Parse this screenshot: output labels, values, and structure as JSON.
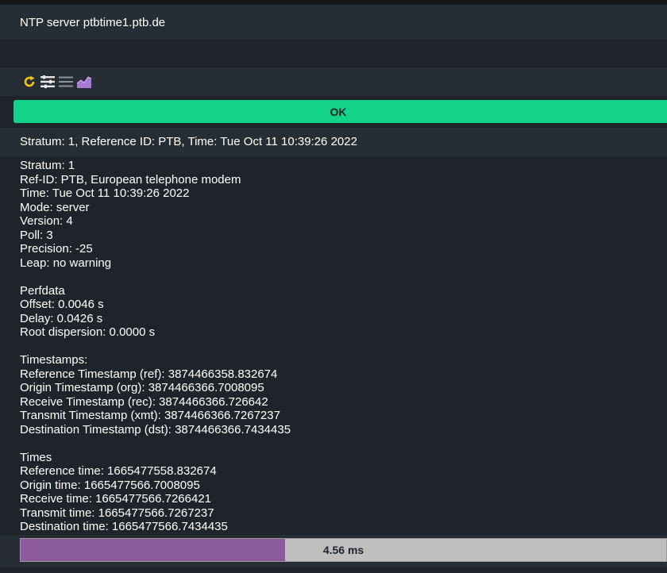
{
  "title": "NTP server ptbtime1.ptb.de",
  "toolbar": {
    "icons": [
      "refresh-icon",
      "filter-icon",
      "list-icon",
      "graph-icon"
    ]
  },
  "status": {
    "label": "OK",
    "color": "#13d389"
  },
  "summary": "Stratum: 1, Reference ID: PTB, Time: Tue Oct 11 10:39:26 2022",
  "details": {
    "lines": [
      "Stratum: 1",
      "Ref-ID: PTB, European telephone modem",
      "Time: Tue Oct 11 10:39:26 2022",
      "Mode: server",
      "Version: 4",
      "Poll: 3",
      "Precision: -25",
      "Leap: no warning",
      "",
      "Perfdata",
      "Offset: 0.0046 s",
      "Delay: 0.0426 s",
      "Root dispersion: 0.0000 s",
      "",
      "Timestamps:",
      "Reference Timestamp (ref): 3874466358.832674",
      "Origin Timestamp (org): 3874466366.7008095",
      "Receive Timestamp (rec): 3874466366.726642",
      "Transmit Timestamp (xmt): 3874466366.7267237",
      "Destination Timestamp (dst): 3874466366.7434435",
      "",
      "Times",
      "Reference time: 1665477558.832674",
      "Origin time: 1665477566.7008095",
      "Receive time: 1665477566.7266421",
      "Transmit time: 1665477566.7267237",
      "Destination time: 1665477566.7434435"
    ]
  },
  "perfometer": {
    "label": "4.56 ms",
    "fraction": 0.41,
    "fill_color": "#8a5b98"
  }
}
